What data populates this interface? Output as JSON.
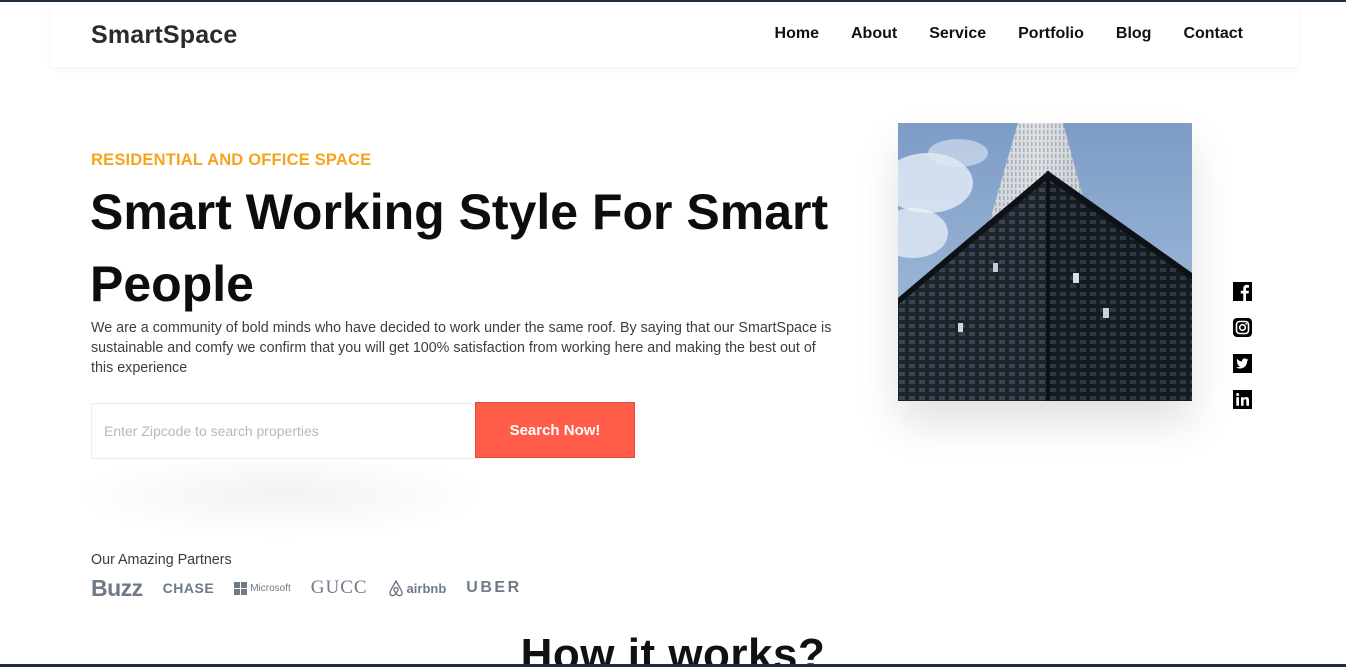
{
  "brand": "SmartSpace",
  "nav": {
    "items": [
      "Home",
      "About",
      "Service",
      "Portfolio",
      "Blog",
      "Contact"
    ]
  },
  "hero": {
    "eyebrow": "RESIDENTIAL AND OFFICE SPACE",
    "headline": "Smart Working Style For Smart People",
    "description": "We are a community of bold minds who have decided to work under the same roof. By saying that our SmartSpace is sustainable and comfy we confirm that you will get 100% satisfaction from working here and making the best out of this experience",
    "image_icon": "skyscraper-photo"
  },
  "search": {
    "placeholder": "Enter Zipcode to search properties",
    "value": "",
    "button_label": "Search Now!"
  },
  "partners": {
    "label": "Our Amazing Partners",
    "logos": [
      "Buzz",
      "CHASE",
      "Microsoft",
      "GUCC",
      "airbnb",
      "UBER"
    ]
  },
  "next_section": {
    "title": "How it works?"
  },
  "social": {
    "icons": [
      "facebook-icon",
      "instagram-icon",
      "twitter-icon",
      "linkedin-icon"
    ]
  },
  "colors": {
    "accent": "#f5a51d",
    "button": "#ff5c4a",
    "text": "#0d0d0d",
    "logo_gray": "#6f7a86",
    "rule": "#1f2d3d"
  }
}
